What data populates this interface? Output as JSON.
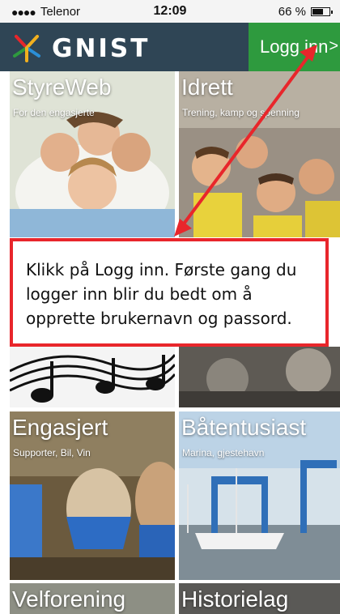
{
  "status_bar": {
    "carrier": "Telenor",
    "time": "12:09",
    "battery": "66 %"
  },
  "header": {
    "brand": "GNIST",
    "login_label": "Logg inn",
    "login_chevron": ">"
  },
  "tiles": [
    {
      "name": "StyreWeb",
      "subtitle": "For den engasjerte"
    },
    {
      "name": "Idrett",
      "subtitle": "Trening, kamp og spenning"
    },
    {
      "name": "Engasjert",
      "subtitle": "Supporter, Bil, Vin"
    },
    {
      "name": "Båtentusiast",
      "subtitle": "Marina, gjestehavn"
    },
    {
      "name": "Velforening",
      "subtitle": ""
    },
    {
      "name": "Historielag",
      "subtitle": ""
    }
  ],
  "annotation": {
    "text": "Klikk på Logg inn. Første gang du logger inn blir du bedt om å opprette brukernavn og passord."
  },
  "colors": {
    "header_bg": "#2f4555",
    "login_green": "#2e9a3e",
    "annotation_red": "#e8262b"
  }
}
